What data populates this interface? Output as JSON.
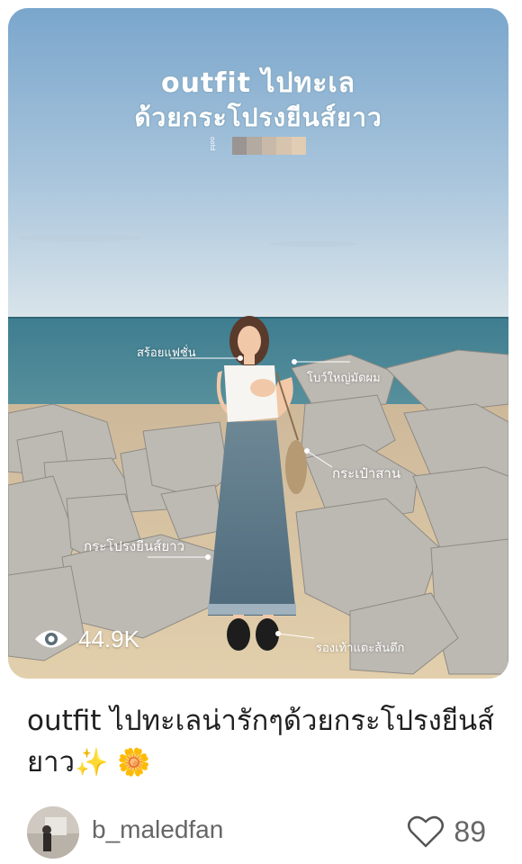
{
  "post": {
    "image": {
      "overlay_title_line1": "outfit ไปทะเล",
      "overlay_title_line2": "ด้วยกระโปรงยีนส์ยาว",
      "small_vertical_text": "ootd",
      "annotations": {
        "necklace": "สร้อยแฟชั่น",
        "hair_bow": "โบว์ใหญ่มัดผม",
        "bag": "กระเป๋าสาน",
        "skirt": "กระโปรงยีนส์ยาว",
        "shoes": "รองเท้าแตะส้นตึก"
      },
      "pixelated_block_colors": [
        "#9a9592",
        "#b3aaa1",
        "#c9b9a8",
        "#d6c4ae",
        "#e0cdb4"
      ]
    },
    "views_icon": "eye-icon",
    "views_count": "44.9K",
    "caption": "outfit ไปทะเลน่ารักๆด้วยกระโปรงยีนส์ยาว",
    "caption_emojis": [
      "✨",
      "🌼"
    ],
    "author": {
      "username": "b_maledfan",
      "avatar_icon": "avatar"
    },
    "like_icon": "heart-icon",
    "like_count": "89"
  },
  "colors": {
    "sky_top": "#7fa9cc",
    "sky_bottom": "#d6e2ea",
    "sea": "#3f7f8f",
    "rocks": "#b9b6b0",
    "sand": "#d9c6a5",
    "caption_text": "#1f1f1f",
    "meta_text": "#666666"
  }
}
